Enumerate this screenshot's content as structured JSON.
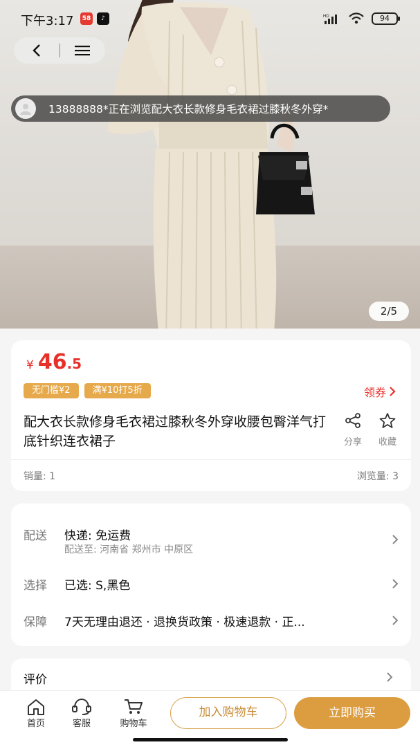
{
  "status_bar": {
    "time": "下午3:17",
    "battery": "94",
    "app_icons": [
      "58-app-icon",
      "tiktok-icon"
    ]
  },
  "gallery": {
    "pager": "2/5"
  },
  "toast": {
    "text": "13888888*正在浏览配大衣长款修身毛衣裙过膝秋冬外穿*"
  },
  "product": {
    "currency": "¥",
    "price_int": "46",
    "price_dec": ".5",
    "tags": [
      "无门槛¥2",
      "满¥10打5折"
    ],
    "coupon_label": "领券",
    "title": "配大衣长款修身毛衣裙过膝秋冬外穿收腰包臀洋气打底针织连衣裙子",
    "share_label": "分享",
    "favorite_label": "收藏",
    "sales": "销量: 1",
    "views": "浏览量: 3"
  },
  "details": {
    "delivery_key": "配送",
    "delivery_value": "快递: 免运费",
    "delivery_sub": "配送至: 河南省 郑州市 中原区",
    "select_key": "选择",
    "select_value": "已选: S,黑色",
    "guarantee_key": "保障",
    "guarantee_value": "7天无理由退还 · 退换货政策 · 极速退款 · 正..."
  },
  "reviews": {
    "label": "评价"
  },
  "bottom_bar": {
    "home": "首页",
    "service": "客服",
    "cart": "购物车",
    "add_to_cart": "加入购物车",
    "buy_now": "立即购买"
  },
  "colors": {
    "price": "#e8302b",
    "tag": "#e6a94b",
    "buy_button": "#dc9c40"
  }
}
